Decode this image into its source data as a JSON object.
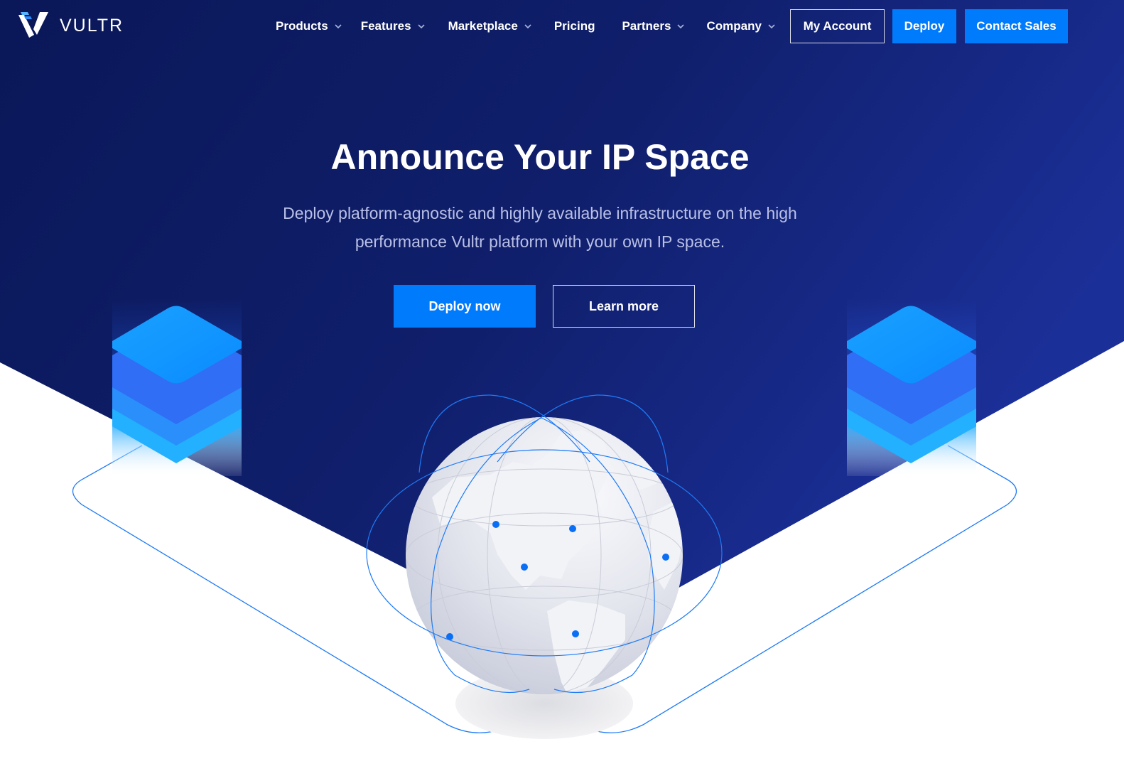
{
  "brand": {
    "name": "VULTR",
    "logo_icon": "vultr-v-logo"
  },
  "nav": {
    "items": [
      {
        "label": "Products",
        "has_dropdown": true
      },
      {
        "label": "Features",
        "has_dropdown": true
      },
      {
        "label": "Marketplace",
        "has_dropdown": true
      },
      {
        "label": "Pricing",
        "has_dropdown": false
      },
      {
        "label": "Partners",
        "has_dropdown": true
      },
      {
        "label": "Company",
        "has_dropdown": true
      }
    ],
    "account_label": "My Account",
    "deploy_label": "Deploy",
    "contact_label": "Contact Sales"
  },
  "hero": {
    "title": "Announce Your IP Space",
    "subtitle": "Deploy platform-agnostic and highly available infrastructure on the high performance Vultr platform with your own IP space.",
    "primary_cta": "Deploy now",
    "secondary_cta": "Learn more"
  },
  "colors": {
    "hero_dark": "#0b1a5c",
    "hero_light": "#1a2f9a",
    "accent": "#007bfc",
    "subtitle": "#b9c0e6"
  },
  "illustration": {
    "icons": [
      "server-stack-icon-left",
      "server-stack-icon-right",
      "globe-icon"
    ]
  }
}
